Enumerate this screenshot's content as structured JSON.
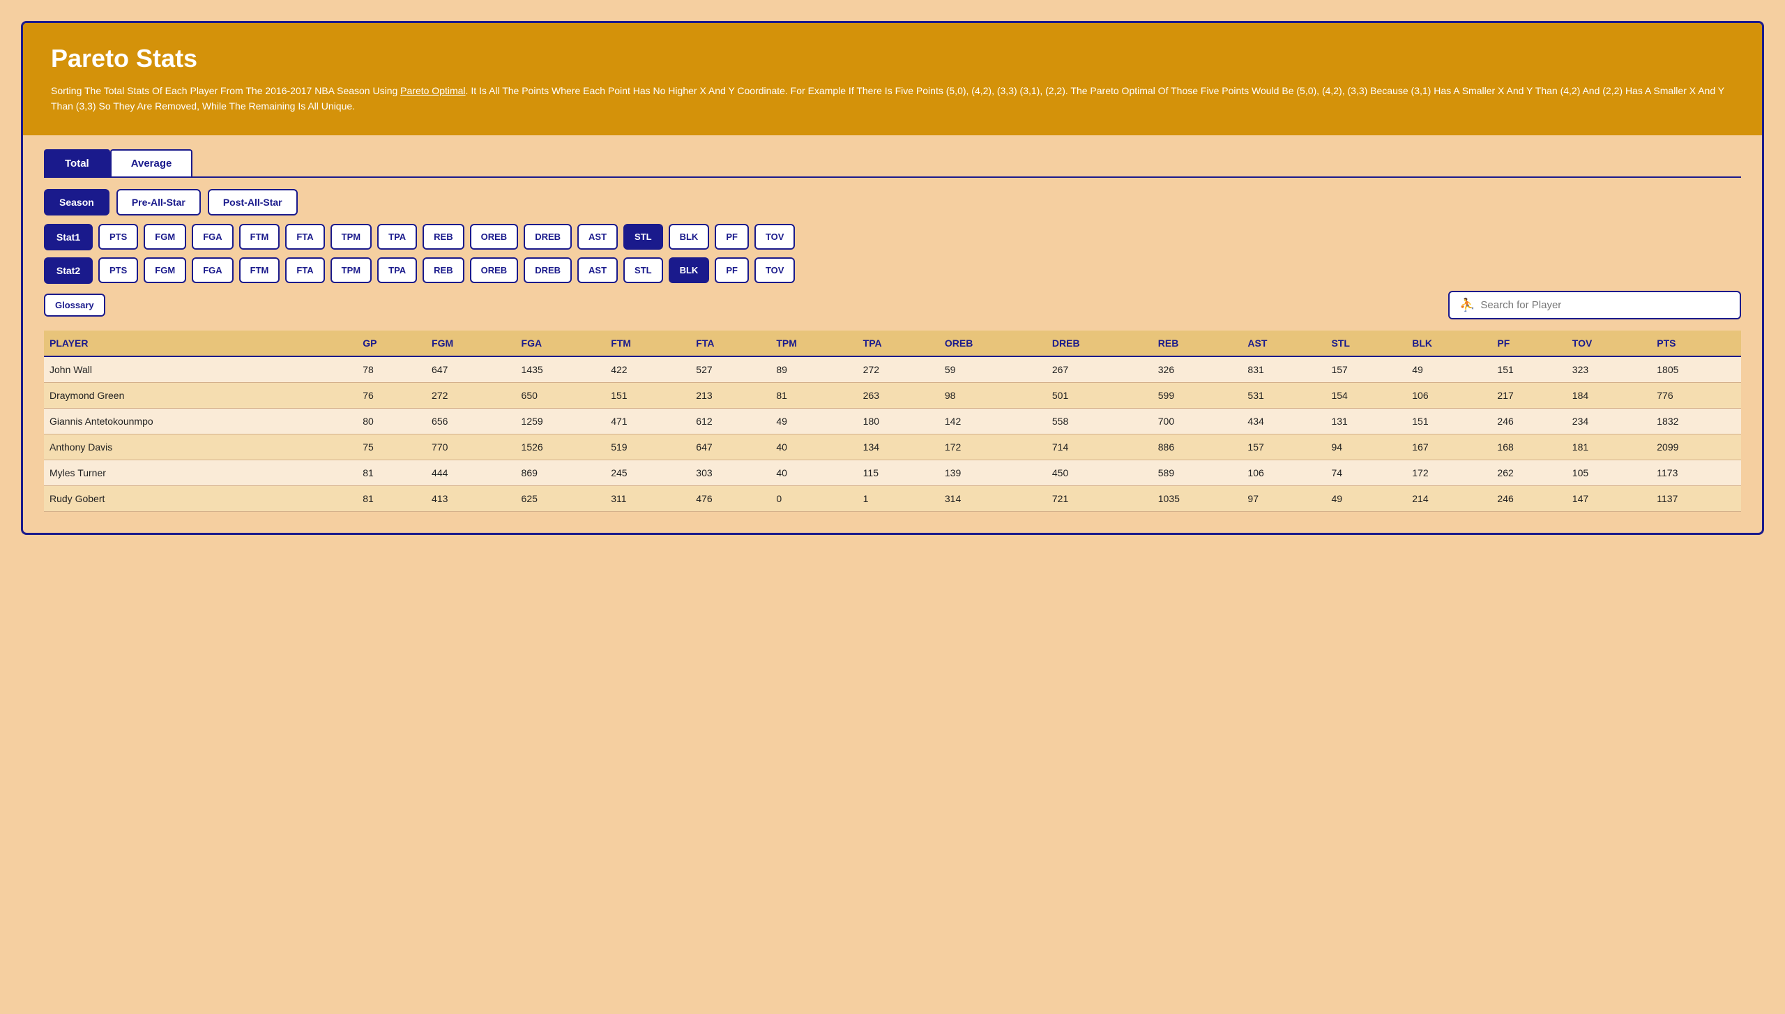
{
  "header": {
    "title": "Pareto Stats",
    "description": "Sorting The Total Stats Of Each Player From The 2016-2017 NBA Season Using Pareto Optimal. It Is All The Points Where Each Point Has No Higher X And Y Coordinate. For Example If There Is Five Points (5,0), (4,2), (3,3) (3,1), (2,2). The Pareto Optimal Of Those Five Points Would Be (5,0), (4,2), (3,3) Because (3,1) Has A Smaller X And Y Than (4,2) And (2,2) Has A Smaller X And Y Than (3,3) So They Are Removed, While The Remaining Is All Unique.",
    "pareto_link": "Pareto Optimal"
  },
  "tabs": [
    {
      "id": "total",
      "label": "Total",
      "active": true
    },
    {
      "id": "average",
      "label": "Average",
      "active": false
    }
  ],
  "period_filters": [
    {
      "id": "season",
      "label": "Season",
      "active": true
    },
    {
      "id": "pre-all-star",
      "label": "Pre-All-Star",
      "active": false
    },
    {
      "id": "post-all-star",
      "label": "Post-All-Star",
      "active": false
    }
  ],
  "stat1_label": "Stat1",
  "stat2_label": "Stat2",
  "stat_options": [
    "PTS",
    "FGM",
    "FGA",
    "FTM",
    "FTA",
    "TPM",
    "TPA",
    "REB",
    "OREB",
    "DREB",
    "AST",
    "STL",
    "BLK",
    "PF",
    "TOV"
  ],
  "stat1_active": "STL",
  "stat2_active": "BLK",
  "glossary_label": "Glossary",
  "search_placeholder": "Search for Player",
  "table": {
    "columns": [
      "PLAYER",
      "GP",
      "FGM",
      "FGA",
      "FTM",
      "FTA",
      "TPM",
      "TPA",
      "OREB",
      "DREB",
      "REB",
      "AST",
      "STL",
      "BLK",
      "PF",
      "TOV",
      "PTS"
    ],
    "rows": [
      [
        "John Wall",
        78,
        647,
        1435,
        422,
        527,
        89,
        272,
        59,
        267,
        326,
        831,
        157,
        49,
        151,
        323,
        1805
      ],
      [
        "Draymond Green",
        76,
        272,
        650,
        151,
        213,
        81,
        263,
        98,
        501,
        599,
        531,
        154,
        106,
        217,
        184,
        776
      ],
      [
        "Giannis Antetokounmpo",
        80,
        656,
        1259,
        471,
        612,
        49,
        180,
        142,
        558,
        700,
        434,
        131,
        151,
        246,
        234,
        1832
      ],
      [
        "Anthony Davis",
        75,
        770,
        1526,
        519,
        647,
        40,
        134,
        172,
        714,
        886,
        157,
        94,
        167,
        168,
        181,
        2099
      ],
      [
        "Myles Turner",
        81,
        444,
        869,
        245,
        303,
        40,
        115,
        139,
        450,
        589,
        106,
        74,
        172,
        262,
        105,
        1173
      ],
      [
        "Rudy Gobert",
        81,
        413,
        625,
        311,
        476,
        0,
        1,
        314,
        721,
        1035,
        97,
        49,
        214,
        246,
        147,
        1137
      ]
    ]
  },
  "colors": {
    "navy": "#1a1a8c",
    "gold": "#d4920a",
    "bg": "#f5cfa0",
    "header_bg": "#d4920a",
    "table_header_bg": "#e8c47a"
  }
}
